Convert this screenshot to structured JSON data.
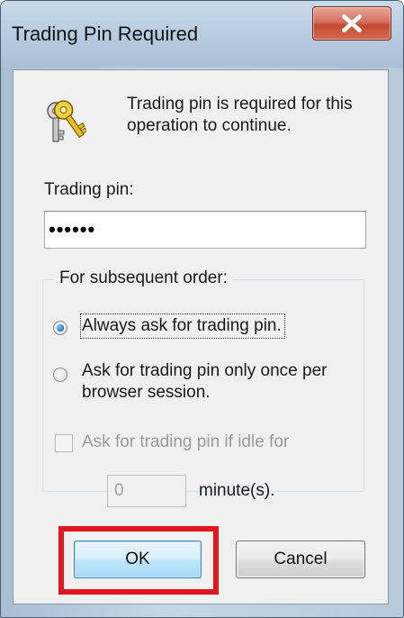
{
  "window": {
    "title": "Trading Pin Required",
    "close_glyph": "X"
  },
  "icons": {
    "key": "keys-icon",
    "close": "close-icon"
  },
  "message": "Trading pin is required for this operation to continue.",
  "pin": {
    "label": "Trading pin:",
    "value": "••••••"
  },
  "subsequent": {
    "legend": "For subsequent order:",
    "options": [
      {
        "label": "Always ask for trading pin.",
        "checked": true
      },
      {
        "label": "Ask for trading pin only once per browser session.",
        "checked": false
      }
    ]
  },
  "idle": {
    "label": "Ask for trading pin if idle for",
    "checked": false,
    "enabled": false,
    "minutes_value": "0",
    "minutes_label": "minute(s)."
  },
  "buttons": {
    "ok": "OK",
    "cancel": "Cancel"
  },
  "colors": {
    "highlight": "#e3151f",
    "close_button": "#c44a33"
  }
}
